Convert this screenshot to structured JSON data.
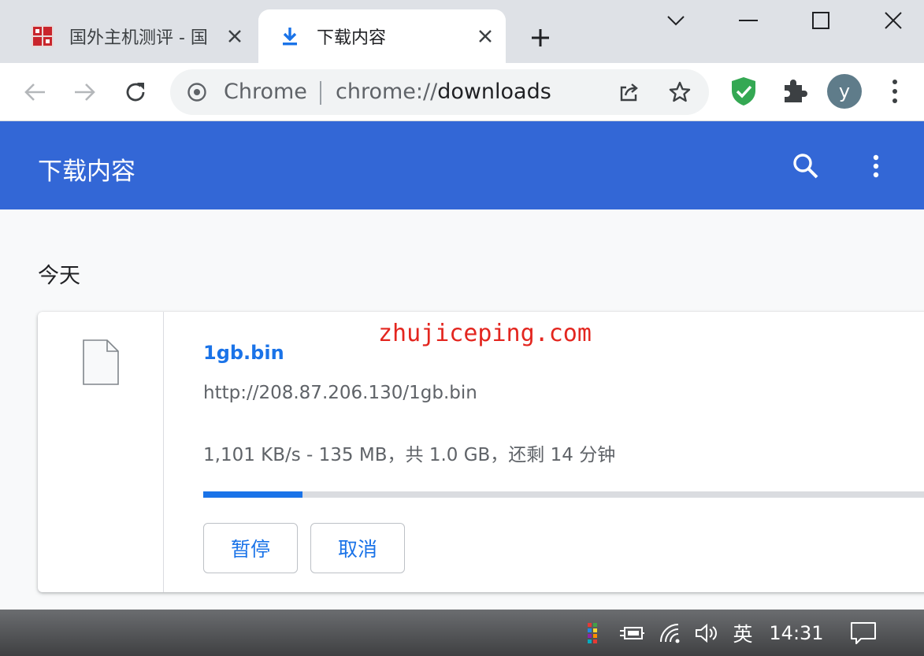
{
  "tabs": [
    {
      "title": "国外主机测评 - 国",
      "active": false,
      "favicon": "site-logo-icon"
    },
    {
      "title": "下载内容",
      "active": true,
      "favicon": "download-icon"
    }
  ],
  "toolbar": {
    "omnibox_chip": "Chrome",
    "url_scheme": "chrome://",
    "url_path": "downloads",
    "avatar_initial": "y"
  },
  "downloads": {
    "page_title": "下载内容",
    "date_heading": "今天",
    "items": [
      {
        "file_name": "1gb.bin",
        "url": "http://208.87.206.130/1gb.bin",
        "status": "1,101 KB/s - 135 MB，共 1.0 GB，还剩 14 分钟",
        "progress_fraction": 0.135,
        "pause_label": "暂停",
        "cancel_label": "取消"
      }
    ]
  },
  "watermark": "zhujiceping.com",
  "taskbar": {
    "language": "英",
    "clock": "14:31"
  },
  "colors": {
    "accent": "#3367d6",
    "link": "#1a73e8",
    "tab_strip": "#dee1e6",
    "watermark": "#e3261f"
  }
}
